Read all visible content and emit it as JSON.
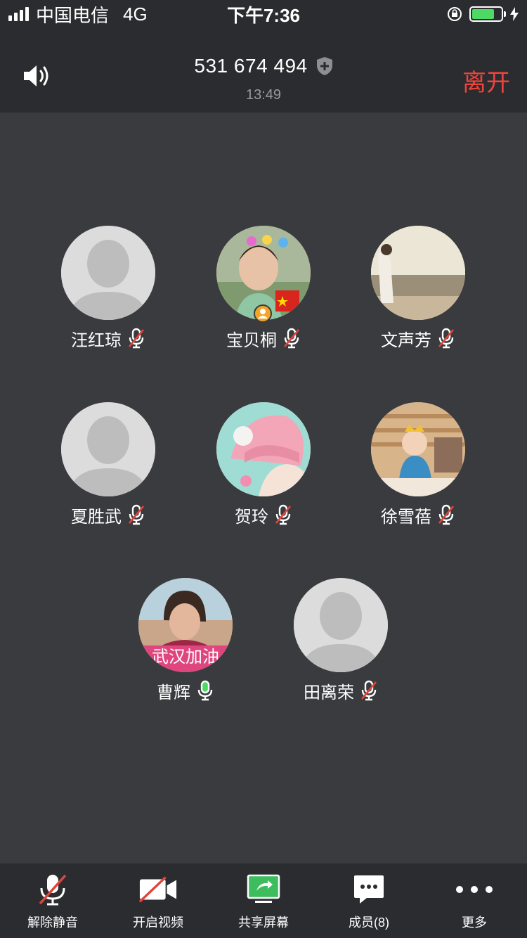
{
  "status_bar": {
    "carrier": "中国电信",
    "network": "4G",
    "time": "下午7:36"
  },
  "header": {
    "meeting_id": "531 674 494",
    "duration": "13:49",
    "leave_label": "离开",
    "speaker_icon": "speaker-icon",
    "shield_icon": "shield-plus-icon"
  },
  "participants": [
    {
      "name": "汪红琼",
      "avatar": "placeholder",
      "mic": "muted"
    },
    {
      "name": "宝贝桐",
      "avatar": "photo-child",
      "mic": "muted",
      "host_badge": true
    },
    {
      "name": "文声芳",
      "avatar": "photo-beach",
      "mic": "muted"
    },
    {
      "name": "夏胜武",
      "avatar": "placeholder",
      "mic": "muted"
    },
    {
      "name": "贺玲",
      "avatar": "photo-pink-hat",
      "mic": "muted"
    },
    {
      "name": "徐雪蓓",
      "avatar": "photo-baby",
      "mic": "muted"
    },
    {
      "name": "曹辉",
      "avatar": "photo-woman",
      "mic": "active",
      "avatar_text": "武汉加油"
    },
    {
      "name": "田离荣",
      "avatar": "placeholder",
      "mic": "muted"
    }
  ],
  "toolbar": {
    "unmute_label": "解除静音",
    "video_label": "开启视频",
    "share_label": "共享屏幕",
    "members_label": "成员(8)",
    "more_label": "更多"
  },
  "colors": {
    "background": "#3a3b3e",
    "bar": "#2b2c2f",
    "leave": "#f0443b",
    "mute_slash": "#e0443b",
    "mic_active": "#4cd964",
    "share": "#3dbd5e"
  }
}
